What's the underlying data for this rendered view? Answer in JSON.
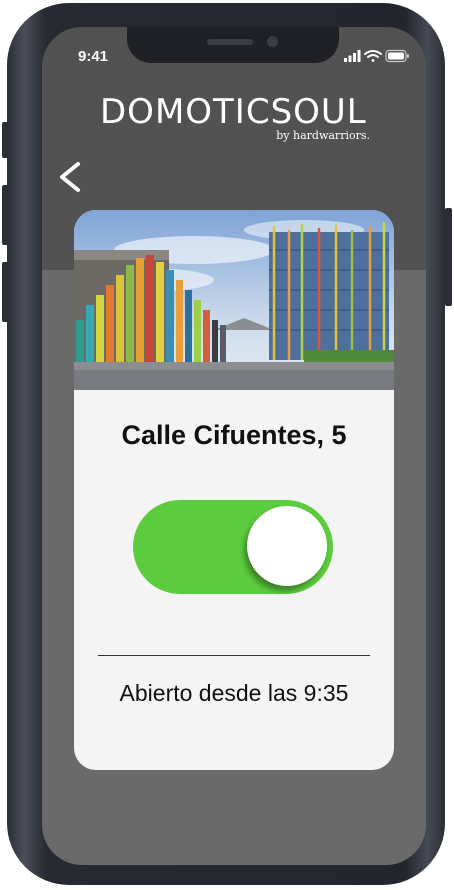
{
  "status_bar": {
    "time": "9:41",
    "icons": [
      "signal-icon",
      "wifi-icon",
      "battery-icon"
    ]
  },
  "header": {
    "logo_text": "DOMOTICSOUL",
    "logo_tagline": "by hardwarriors."
  },
  "navigation": {
    "back_icon": "chevron-left-icon"
  },
  "door": {
    "address": "Calle Cifuentes, 5",
    "is_open": true,
    "status_text": "Abierto desde las 9:35"
  },
  "colors": {
    "toggle_on": "#5ccc3e",
    "card_background": "#f4f4f4",
    "screen_background": "#6a6a6a"
  }
}
